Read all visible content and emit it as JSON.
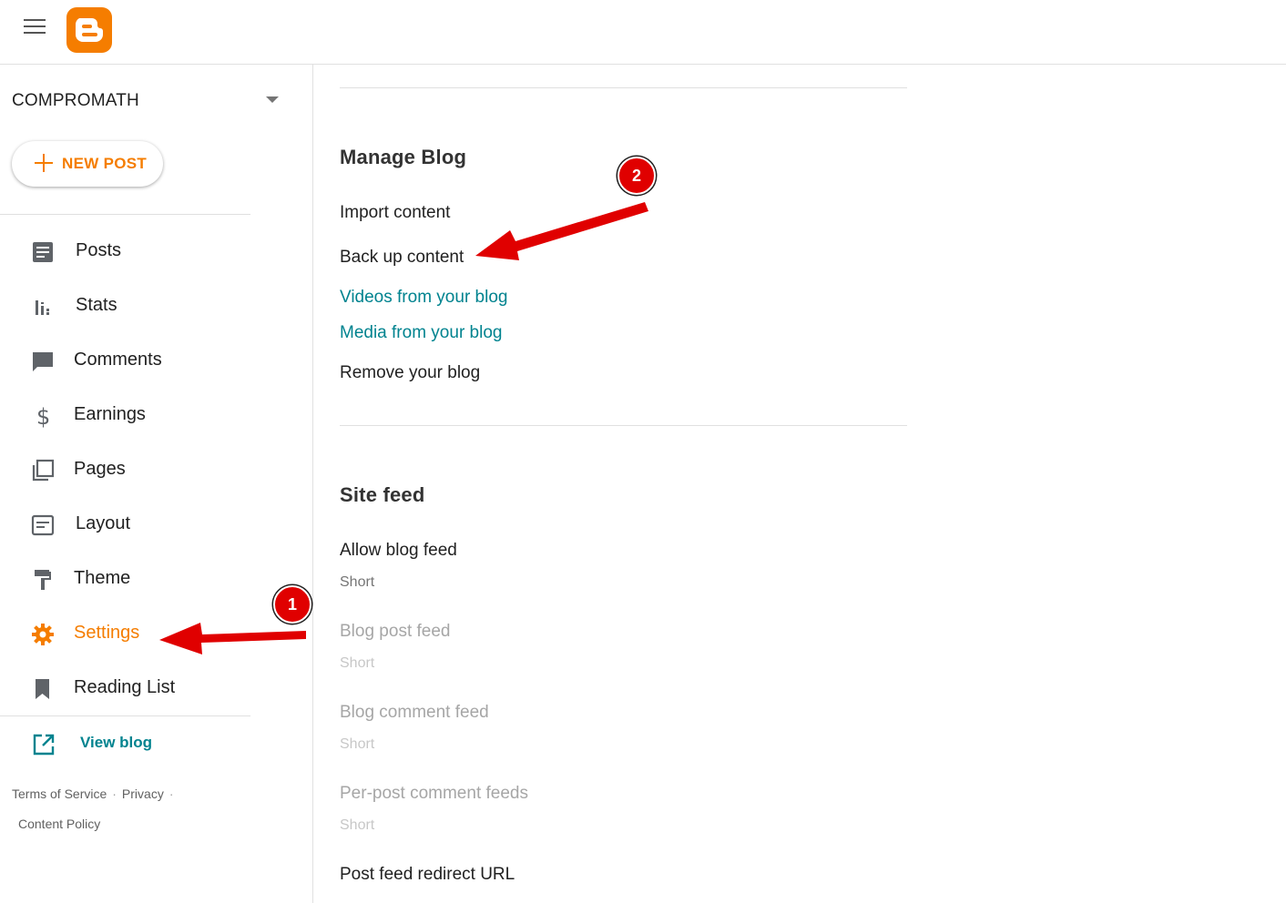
{
  "header": {
    "menu_icon": "hamburger-icon",
    "logo_icon": "blogger-logo-icon"
  },
  "sidebar": {
    "blog_name": "COMPROMATH",
    "new_post_label": "NEW POST",
    "items": [
      {
        "label": "Posts",
        "icon": "posts-icon"
      },
      {
        "label": "Stats",
        "icon": "stats-icon"
      },
      {
        "label": "Comments",
        "icon": "comments-icon"
      },
      {
        "label": "Earnings",
        "icon": "dollar-icon"
      },
      {
        "label": "Pages",
        "icon": "pages-icon"
      },
      {
        "label": "Layout",
        "icon": "layout-icon"
      },
      {
        "label": "Theme",
        "icon": "paint-roller-icon"
      },
      {
        "label": "Settings",
        "icon": "gear-icon",
        "active": true
      },
      {
        "label": "Reading List",
        "icon": "bookmark-icon"
      }
    ],
    "view_blog_label": "View blog",
    "footer": {
      "terms": "Terms of Service",
      "privacy": "Privacy",
      "content_policy": "Content Policy",
      "separator": "·"
    }
  },
  "main": {
    "manage_blog": {
      "title": "Manage Blog",
      "items": [
        "Import content",
        "Back up content",
        "Videos from your blog",
        "Media from your blog",
        "Remove your blog"
      ]
    },
    "site_feed": {
      "title": "Site feed",
      "items": [
        {
          "label": "Allow blog feed",
          "value": "Short"
        },
        {
          "label": "Blog post feed",
          "value": "Short"
        },
        {
          "label": "Blog comment feed",
          "value": "Short"
        },
        {
          "label": "Per-post comment feeds",
          "value": "Short"
        }
      ],
      "redirect_label": "Post feed redirect URL"
    }
  },
  "annotations": {
    "badge_1": "1",
    "badge_2": "2"
  },
  "colors": {
    "accent": "#f57d00",
    "link": "#00838f",
    "annotation": "#e00000"
  }
}
